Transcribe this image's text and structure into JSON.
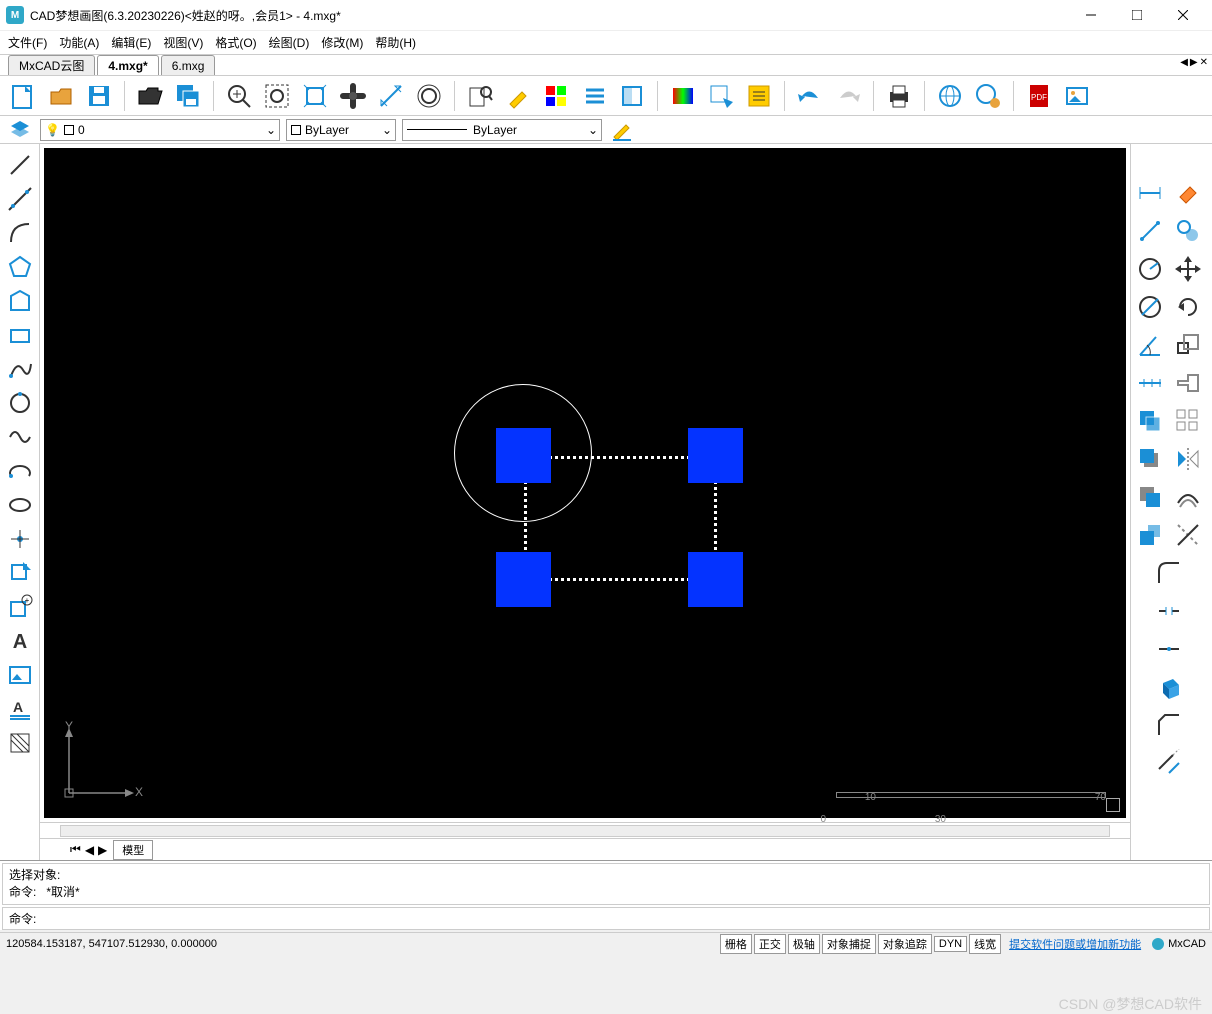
{
  "title": "CAD梦想画图(6.3.20230226)<姓赵的呀。,会员1> - 4.mxg*",
  "app_icon_letter": "M",
  "menu": {
    "file": "文件(F)",
    "func": "功能(A)",
    "edit": "编辑(E)",
    "view": "视图(V)",
    "format": "格式(O)",
    "draw": "绘图(D)",
    "modify": "修改(M)",
    "help": "帮助(H)"
  },
  "tabs": [
    {
      "label": "MxCAD云图",
      "active": false
    },
    {
      "label": "4.mxg*",
      "active": true
    },
    {
      "label": "6.mxg",
      "active": false
    }
  ],
  "layer": {
    "current": "0",
    "linetype": "ByLayer",
    "lineweight": "ByLayer"
  },
  "model_tab": "模型",
  "cmd": {
    "hist1": "选择对象:",
    "hist2_prefix": "命令:",
    "hist2_body": "*取消*",
    "prompt": "命令:"
  },
  "status": {
    "coords": "120584.153187,  547107.512930,  0.000000",
    "b1": "栅格",
    "b2": "正交",
    "b3": "极轴",
    "b4": "对象捕捉",
    "b5": "对象追踪",
    "b6": "DYN",
    "b7": "线宽",
    "link": "提交软件问题或增加新功能",
    "brand": "MxCAD"
  },
  "ruler": {
    "a": "10",
    "b": "30",
    "c": "70"
  },
  "axis": {
    "x": "X",
    "y": "Y"
  },
  "watermark": "CSDN @梦想CAD软件"
}
